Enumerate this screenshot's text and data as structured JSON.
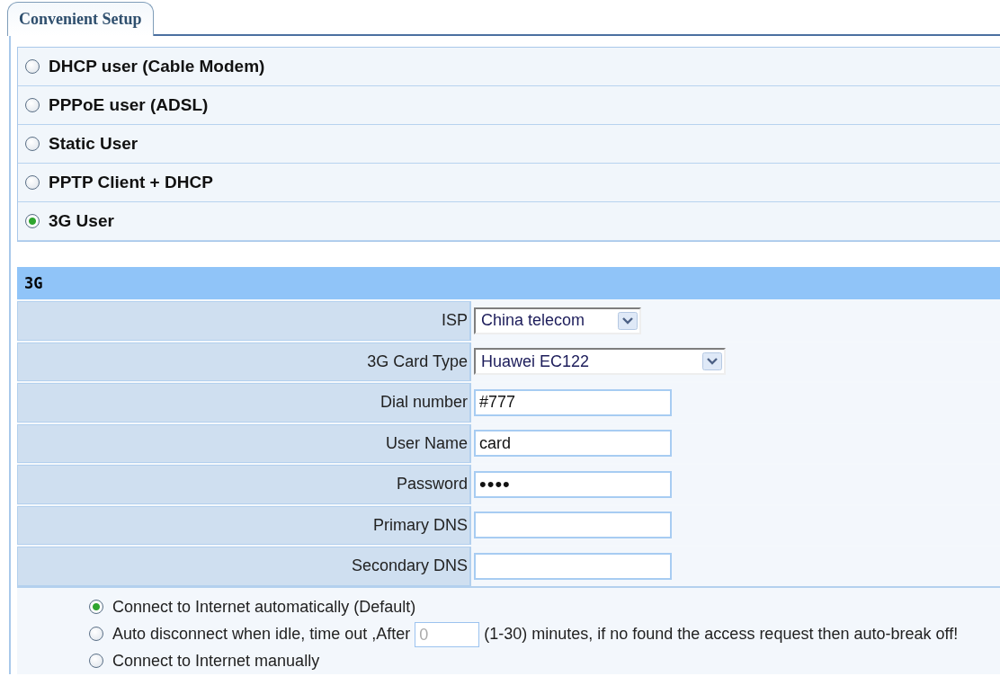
{
  "tab": {
    "label": "Convenient Setup",
    "selected": true
  },
  "modes": [
    {
      "label": "DHCP user (Cable Modem)",
      "selected": false
    },
    {
      "label": "PPPoE user (ADSL)",
      "selected": false
    },
    {
      "label": "Static User",
      "selected": false
    },
    {
      "label": "PPTP Client + DHCP",
      "selected": false
    },
    {
      "label": "3G User",
      "selected": true
    }
  ],
  "section": {
    "title": "3G"
  },
  "fields": [
    {
      "kind": "select",
      "label": "ISP",
      "value": "China telecom"
    },
    {
      "kind": "select-wide",
      "label": "3G Card Type",
      "value": "Huawei EC122"
    },
    {
      "kind": "text",
      "label": "Dial number",
      "value": "#777"
    },
    {
      "kind": "text",
      "label": "User Name",
      "value": "card"
    },
    {
      "kind": "text",
      "label": "Password",
      "value": "••••"
    },
    {
      "kind": "text",
      "label": "Primary DNS"
    },
    {
      "kind": "text",
      "label": "Secondary DNS"
    }
  ],
  "connect_options": [
    {
      "kind": "plain",
      "label": "Connect to Internet automatically (Default)",
      "selected": true
    },
    {
      "kind": "idle",
      "label_before": "Auto disconnect when idle, time out ,After",
      "idle_field": {
        "value": "0",
        "disabled": true
      },
      "label_after": "(1-30) minutes, if no found the access request then auto-break off!",
      "selected": false
    },
    {
      "kind": "plain",
      "label": "Connect to Internet manually",
      "selected": false
    }
  ]
}
